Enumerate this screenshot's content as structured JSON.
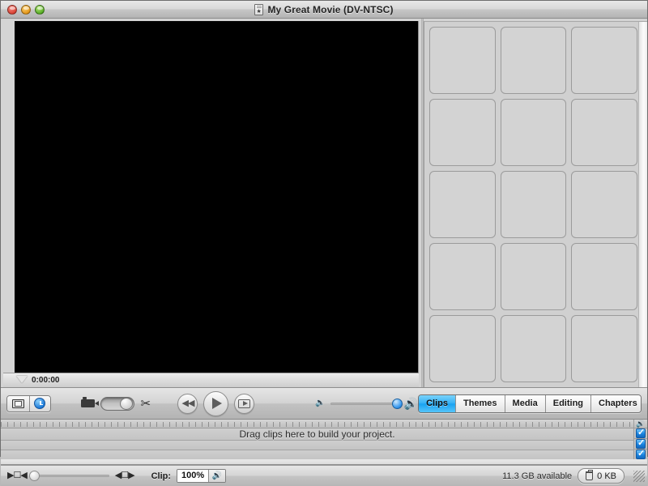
{
  "window": {
    "title": "My Great Movie  (DV-NTSC)",
    "proxy_icon": "movie-document-icon",
    "traffic_lights": [
      {
        "name": "close-button",
        "label": "Close",
        "color": "#d63b2d"
      },
      {
        "name": "minimize-button",
        "label": "Minimize",
        "color": "#e0900f"
      },
      {
        "name": "zoom-button",
        "label": "Zoom",
        "color": "#4da61d"
      }
    ]
  },
  "monitor": {
    "timecode": "0:00:00",
    "playhead_icon": "playhead-marker-icon"
  },
  "browser": {
    "placeholder_cell_count": 15,
    "columns": 3
  },
  "controls": {
    "view_mode": {
      "options": [
        {
          "name": "camera-view-button",
          "icon": "monitor-icon",
          "selected": false
        },
        {
          "name": "clock-view-button",
          "icon": "clock-icon",
          "selected": true
        }
      ]
    },
    "camera_icon": "video-camera-icon",
    "mode_switch": {
      "name": "camera-edit-mode-switch",
      "state": "edit"
    },
    "scissors_icon": "✂",
    "transport": [
      {
        "name": "rewind-to-start-button",
        "glyph": "◀◀",
        "label": "Go to start"
      },
      {
        "name": "play-button",
        "glyph": "▶",
        "label": "Play"
      },
      {
        "name": "play-fullscreen-button",
        "glyph": "▶",
        "label": "Play full screen"
      }
    ],
    "volume": {
      "label": "Volume",
      "value": 100,
      "min_icon": "speaker-low-icon",
      "max_icon": "speaker-high-icon"
    },
    "tabs": [
      {
        "label": "Clips",
        "selected": true
      },
      {
        "label": "Themes",
        "selected": false
      },
      {
        "label": "Media",
        "selected": false
      },
      {
        "label": "Editing",
        "selected": false
      },
      {
        "label": "Chapters",
        "selected": false
      }
    ],
    "tab_accent": "#19a3f2"
  },
  "timeline": {
    "drag_hint": "Drag clips here to build your project.",
    "audio_header_icon": "speaker-icon",
    "tracks": [
      {
        "name": "video-track",
        "checked": true
      },
      {
        "name": "audio-track-1",
        "checked": true
      },
      {
        "name": "audio-track-2",
        "checked": true
      }
    ]
  },
  "statusbar": {
    "zoom_small_icon": "zoom-out-icon",
    "zoom_large_icon": "zoom-in-icon",
    "zoom_value": 0,
    "clip_label": "Clip:",
    "clip_value": "100%",
    "clip_audio_icon": "speaker-icon",
    "disk_available": "11.3 GB available",
    "trash": {
      "icon": "trash-icon",
      "size": "0 KB"
    },
    "resize_grip": "resize-grip-icon"
  }
}
